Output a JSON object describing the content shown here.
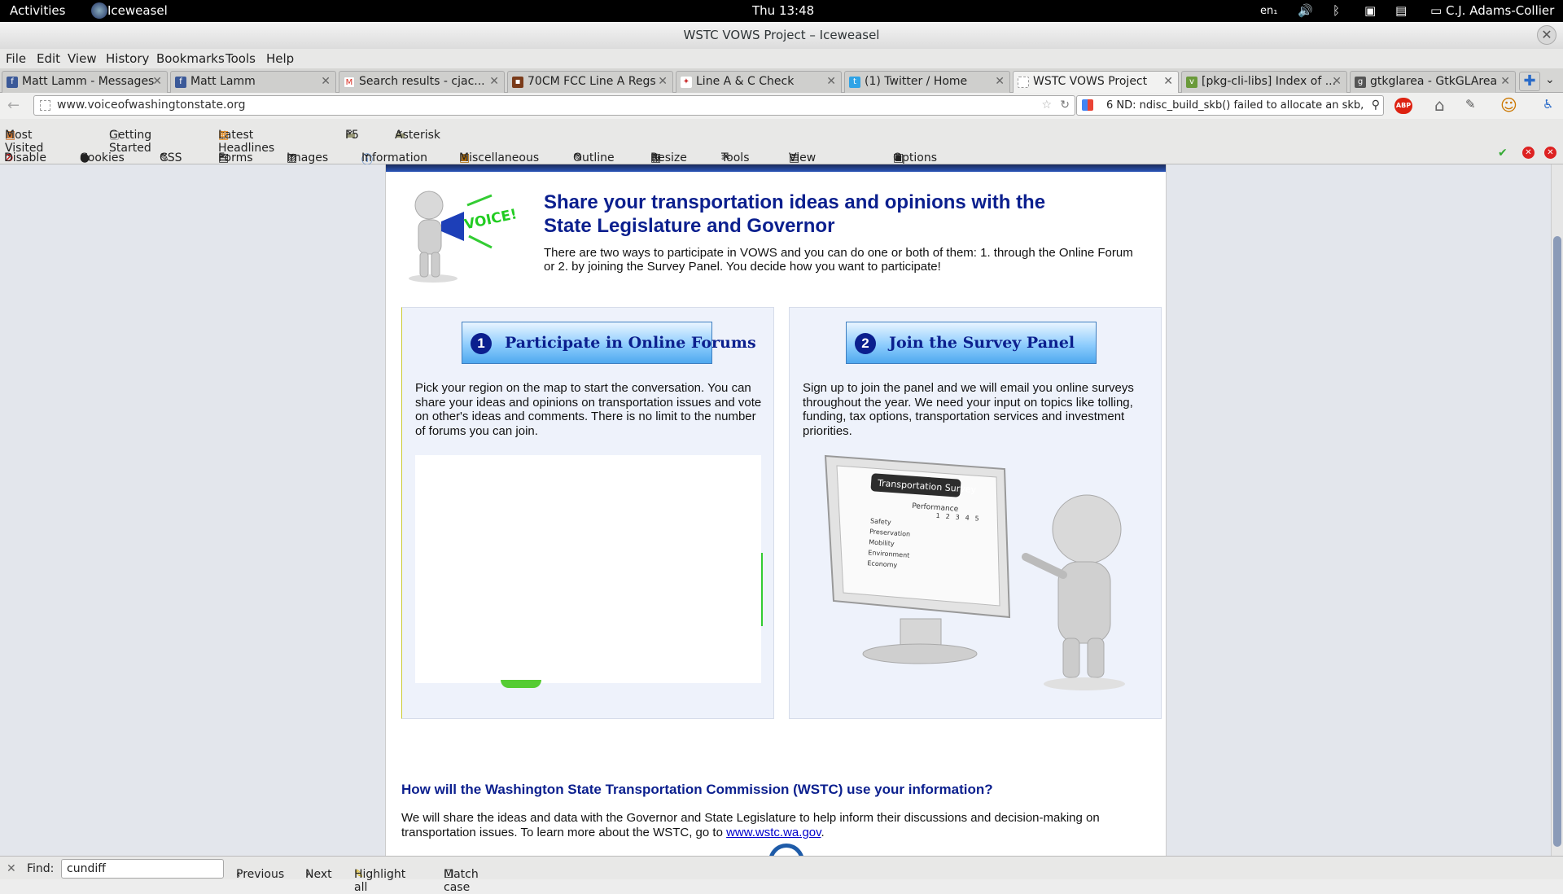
{
  "system_bar": {
    "activities": "Activities",
    "app": "Iceweasel",
    "clock": "Thu 13:48",
    "keyboard": "en₁",
    "user": "C.J. Adams-Collier"
  },
  "window": {
    "title": "WSTC VOWS Project – Iceweasel"
  },
  "menu": [
    "File",
    "Edit",
    "View",
    "History",
    "Bookmarks",
    "Tools",
    "Help"
  ],
  "tabs": [
    {
      "label": "Matt Lamm - Messages",
      "icon_color": "#3b5998",
      "icon": "f"
    },
    {
      "label": "Matt Lamm",
      "icon_color": "#3b5998",
      "icon": "f"
    },
    {
      "label": "Search results - cjac...",
      "icon_color": "#d93025",
      "icon": "M"
    },
    {
      "label": "70CM FCC Line A Regs",
      "icon_color": "#7a3b1a",
      "icon": "▪"
    },
    {
      "label": "Line A & C Check",
      "icon_color": "#c33",
      "icon": "✦"
    },
    {
      "label": "(1) Twitter / Home",
      "icon_color": "#2fa3e6",
      "icon": "t"
    },
    {
      "label": "WSTC VOWS Project",
      "icon_color": "#ffffff",
      "icon": ""
    },
    {
      "label": "[pkg-cli-libs] Index of ...",
      "icon_color": "#6a9a3a",
      "icon": "v"
    },
    {
      "label": "gtkglarea - GtkGLArea",
      "icon_color": "#555555",
      "icon": "g"
    }
  ],
  "nav": {
    "url": "www.voiceofwashingtonstate.org",
    "search": "6 ND: ndisc_build_skb() failed to allocate an skb,"
  },
  "bookmarks": [
    "Most Visited",
    "Getting Started",
    "Latest Headlines",
    "F5",
    "Asterisk"
  ],
  "devtools": [
    "Disable",
    "Cookies",
    "CSS",
    "Forms",
    "Images",
    "Information",
    "Miscellaneous",
    "Outline",
    "Resize",
    "Tools",
    "View Source",
    "Options"
  ],
  "page": {
    "megaphone_text": "VOICE!",
    "heading": "Share your transportation ideas and opinions with the State Legislature and Governor",
    "intro": "There are two ways to participate in VOWS and you can do one or both of them: 1. through the Online Forum or 2. by joining the Survey Panel. You decide how you want to participate!",
    "forum_btn": {
      "num": "1",
      "label": "Participate in Online Forums"
    },
    "forum_text": "Pick your region on the map to start the conversation. You can share your ideas and opinions on transportation issues and vote on other's ideas and comments. There is no limit to the number of forums you can join.",
    "survey_btn": {
      "num": "2",
      "label": "Join the Survey Panel"
    },
    "survey_text": "Sign up to join the panel and we will email you online surveys throughout the year. We need your input on topics like tolling, funding, tax options, transportation services and investment priorities.",
    "survey_image": {
      "title": "Transportation Survey",
      "performance": "Performance",
      "scale": [
        "1",
        "2",
        "3",
        "4",
        "5"
      ],
      "rows": [
        "Safety",
        "Preservation",
        "Mobility",
        "Environment",
        "Economy"
      ]
    },
    "wstc_heading": "How will the Washington State Transportation Commission (WSTC) use your information?",
    "wstc_text": "We will share the ideas and data with the Governor and State Legislature to help inform their discussions and decision-making on transportation issues. To learn more about the WSTC, go to",
    "wstc_link": "www.wstc.wa.gov",
    "wstc_end": "."
  },
  "findbar": {
    "label": "Find:",
    "value": "cundiff",
    "previous": "Previous",
    "next": "Next",
    "highlight": "Highlight all",
    "match_case": "Match case"
  }
}
